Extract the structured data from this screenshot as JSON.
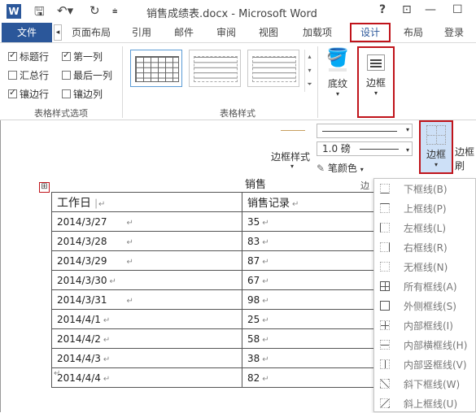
{
  "window": {
    "title": "销售成绩表.docx - Microsoft Word",
    "help": "?",
    "restore": "⊡",
    "minimize": "—",
    "maximize": "☐"
  },
  "tabs": {
    "file": "文件",
    "items": [
      "页面布局",
      "引用",
      "邮件",
      "审阅",
      "视图",
      "加载项",
      "设计",
      "布局"
    ],
    "login": "登录"
  },
  "ribbon": {
    "options": {
      "header_row": "标题行",
      "first_col": "第一列",
      "total_row": "汇总行",
      "last_col": "最后一列",
      "banded_rows": "镶边行",
      "banded_cols": "镶边列",
      "group_label": "表格样式选项"
    },
    "styles_group_label": "表格样式",
    "shading_label": "底纹",
    "borders_label": "边框"
  },
  "subribbon": {
    "border_styles_label": "边框样式",
    "weight": "1.0 磅",
    "pen_color": "笔颜色",
    "borders_label": "边框",
    "painter_label": "边框刷",
    "group_label_partial": "边"
  },
  "doc": {
    "caption_partial": "销售",
    "headers": [
      "工作日",
      "销售记录"
    ],
    "rows": [
      [
        "2014/3/27",
        "35"
      ],
      [
        "2014/3/28",
        "83"
      ],
      [
        "2014/3/29",
        "87"
      ],
      [
        "2014/3/30",
        "67"
      ],
      [
        "2014/3/31",
        "98"
      ],
      [
        "2014/4/1",
        "25"
      ],
      [
        "2014/4/2",
        "58"
      ],
      [
        "2014/4/3",
        "38"
      ],
      [
        "2014/4/4",
        "82"
      ]
    ]
  },
  "dropdown": {
    "items": [
      "下框线(B)",
      "上框线(P)",
      "左框线(L)",
      "右框线(R)",
      "无框线(N)",
      "所有框线(A)",
      "外侧框线(S)",
      "内部框线(I)",
      "内部横框线(H)",
      "内部竖框线(V)",
      "斜下框线(W)",
      "斜上框线(U)"
    ]
  },
  "colors": {
    "accent": "#2b579a",
    "highlight": "#c0141b",
    "selected_bg": "#cde0f7"
  }
}
